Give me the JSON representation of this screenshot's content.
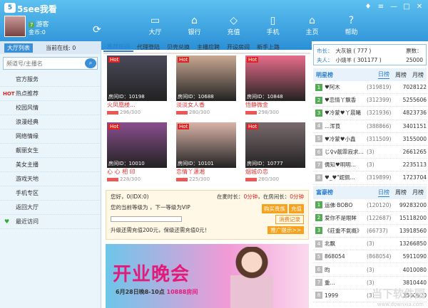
{
  "app": {
    "title": "5see我看",
    "logo": "5"
  },
  "window": {
    "min": "—",
    "max": "□",
    "close": "✕",
    "menu": "≡",
    "skin": "♦"
  },
  "user": {
    "name": "游客",
    "coin": "金币:0",
    "level": "7"
  },
  "nav": [
    {
      "label": "大厅",
      "icon": "hall-icon"
    },
    {
      "label": "银行",
      "icon": "bank-icon"
    },
    {
      "label": "充值",
      "icon": "diamond-icon"
    },
    {
      "label": "手机",
      "icon": "phone-icon"
    },
    {
      "label": "主页",
      "icon": "home-icon"
    },
    {
      "label": "帮助",
      "icon": "help-icon"
    }
  ],
  "sidebar": {
    "tab": "大厅列表",
    "online": "当前在线: 0",
    "search_placeholder": "频道号/主播名",
    "items": [
      {
        "label": "官方服务"
      },
      {
        "label": "热点推荐",
        "badge": "HOT"
      },
      {
        "label": "校园风情"
      },
      {
        "label": "浪漫经典"
      },
      {
        "label": "网络情缘"
      },
      {
        "label": "靓丽女生"
      },
      {
        "label": "美女主播"
      },
      {
        "label": "游戏天地"
      },
      {
        "label": "手机专区"
      },
      {
        "label": "返回大厅"
      },
      {
        "label": "最近访问"
      }
    ]
  },
  "tabs": [
    "推荐房间",
    "代理登陆",
    "贝壳兑换",
    "主播应聘",
    "开设房间",
    "新手上路"
  ],
  "rooms": [
    {
      "hot": "Hot",
      "id": "房间ID：10198",
      "name": "火凤凰楼...",
      "count": "296/300",
      "bg": "#4a4a5a"
    },
    {
      "hot": "Hot",
      "id": "房间ID：10688",
      "name": "淡淡女人香",
      "count": "280/300",
      "bg": "#c9a892"
    },
    {
      "hot": "Hot",
      "id": "房间ID：10848",
      "name": "悟静微金",
      "count": "298/300",
      "bg": "#e86c8a"
    },
    {
      "hot": "Hot",
      "id": "房间ID：10010",
      "name": "心 心 相 印",
      "count": "228/300",
      "bg": "#8a4f8f"
    },
    {
      "hot": "Hot",
      "id": "房间ID：10101",
      "name": "恋情丫潇湘",
      "count": "225/300",
      "bg": "#d9b3a8"
    },
    {
      "hot": "Hot",
      "id": "房间ID：10777",
      "name": "烟城の恋",
      "count": "280/300",
      "bg": "#7a6a6e"
    }
  ],
  "info": {
    "greet": "您好，0(IDX:0)",
    "levelup": "您的当前等级为 ，下一等级为VIP",
    "online_t": "在麦时长：",
    "online_v": "0分钟",
    "stay_t": "，在房间长：",
    "stay_v": "0分钟",
    "buy": "购买贵族",
    "recharge": "充值",
    "progress": "升级还需充值200元，保级还需充值0元！",
    "log": "消费记录",
    "promo": "推广提示>>"
  },
  "banner": {
    "title": "开业晚会",
    "date": "6月28日晚8-10点",
    "room": "10888房间"
  },
  "right": {
    "city_k": "市长：",
    "city_v": "大灰狼 ( 777 )",
    "lady_k": "夫人：",
    "lady_v": "小烧羊 ( 301177 )",
    "votes_k": "票数：",
    "votes_v": "25000"
  },
  "star": {
    "title": "明星榜",
    "tabs": [
      "日榜",
      "周榜",
      "月榜"
    ],
    "rows": [
      {
        "n": "1",
        "nm": "♥阿木",
        "id": "(319819)",
        "v": "7028122"
      },
      {
        "n": "2",
        "nm": "♥恋情丫飘香",
        "id": "(312399)",
        "v": "5255606"
      },
      {
        "n": "3",
        "nm": "♥冷蒙♥丫晨曦",
        "id": "(321936)",
        "v": "4823736"
      },
      {
        "n": "4",
        "nm": "...浑茛",
        "id": "(388866)",
        "v": "3401151"
      },
      {
        "n": "5",
        "nm": "♥冷蒙♥小鑫",
        "id": "(311509)",
        "v": "3155000"
      },
      {
        "n": "6",
        "nm": "じ♀v靓霏寂求...",
        "id": "(3)",
        "v": "2661265"
      },
      {
        "n": "7",
        "nm": "儒知♥明明...",
        "id": "(3)",
        "v": "2235113"
      },
      {
        "n": "8",
        "nm": "♥_♥\"妮佩...",
        "id": "(319899)",
        "v": "1723704"
      }
    ]
  },
  "rich": {
    "title": "富豪榜",
    "tabs": [
      "日榜",
      "周榜",
      "月榜"
    ],
    "rows": [
      {
        "n": "1",
        "nm": "运佛·BOBO",
        "id": "(120120)",
        "v": "99283200"
      },
      {
        "n": "2",
        "nm": "爱你不是眼眸",
        "id": "(122687)",
        "v": "15118200"
      },
      {
        "n": "3",
        "nm": "《莊重不氣概》",
        "id": "(66737)",
        "v": "13918560"
      },
      {
        "n": "4",
        "nm": "北飘",
        "id": "(3)",
        "v": "13266850"
      },
      {
        "n": "5",
        "nm": "868054",
        "id": "(868054)",
        "v": "5911090"
      },
      {
        "n": "6",
        "nm": "昀",
        "id": "(3)",
        "v": "4010080"
      },
      {
        "n": "7",
        "nm": "重...",
        "id": "(3)",
        "v": "3810440"
      },
      {
        "n": "8",
        "nm": "1999",
        "id": "(3)",
        "v": "3500000"
      }
    ]
  },
  "watermark": "当下软件园",
  "watermark2": "www.downxia.com"
}
